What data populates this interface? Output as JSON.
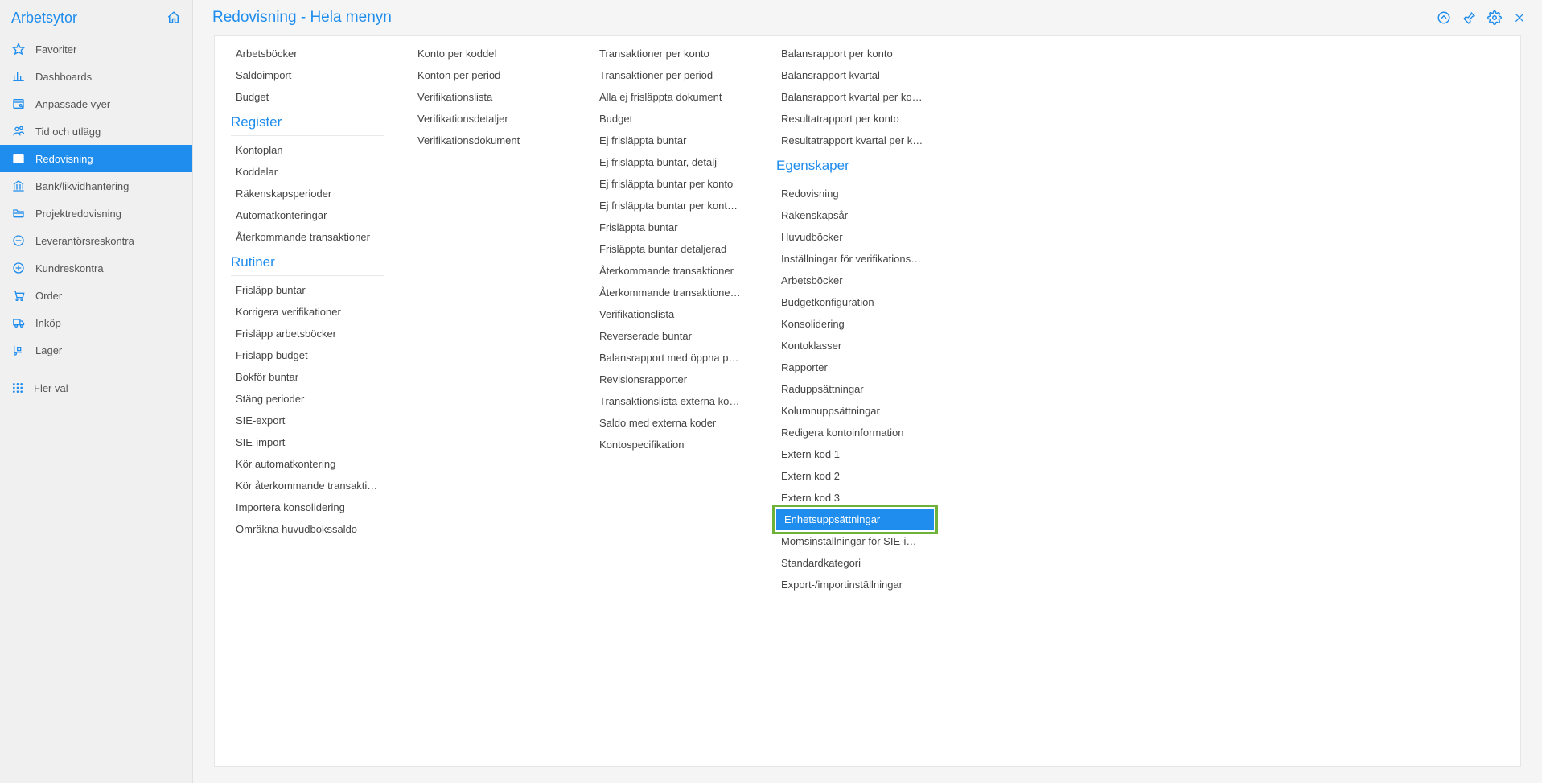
{
  "sidebar": {
    "title": "Arbetsytor",
    "items": [
      {
        "icon": "star",
        "label": "Favoriter"
      },
      {
        "icon": "bar",
        "label": "Dashboards"
      },
      {
        "icon": "view",
        "label": "Anpassade vyer"
      },
      {
        "icon": "user",
        "label": "Tid och utlägg"
      },
      {
        "icon": "dollar",
        "label": "Redovisning",
        "active": true
      },
      {
        "icon": "bank",
        "label": "Bank/likvidhantering"
      },
      {
        "icon": "folder",
        "label": "Projektredovisning"
      },
      {
        "icon": "minus",
        "label": "Leverantörsreskontra"
      },
      {
        "icon": "plus",
        "label": "Kundreskontra"
      },
      {
        "icon": "cart",
        "label": "Order"
      },
      {
        "icon": "truck",
        "label": "Inköp"
      },
      {
        "icon": "dolly",
        "label": "Lager"
      }
    ],
    "more": "Fler val"
  },
  "header": {
    "breadcrumb": "Redovisning - Hela menyn"
  },
  "columns": [
    {
      "blocks": [
        {
          "type": "links",
          "items": [
            "Arbetsböcker",
            "Saldoimport",
            "Budget"
          ]
        },
        {
          "type": "title",
          "text": "Register"
        },
        {
          "type": "links",
          "items": [
            "Kontoplan",
            "Koddelar",
            "Räkenskapsperioder",
            "Automatkonteringar",
            "Återkommande transaktioner"
          ]
        },
        {
          "type": "title",
          "text": "Rutiner"
        },
        {
          "type": "links",
          "items": [
            "Frisläpp buntar",
            "Korrigera verifikationer",
            "Frisläpp arbetsböcker",
            "Frisläpp budget",
            "Bokför buntar",
            "Stäng perioder",
            "SIE-export",
            "SIE-import",
            "Kör automatkontering",
            "Kör återkommande transaktioner",
            "Importera konsolidering",
            "Omräkna huvudbokssaldo"
          ]
        }
      ]
    },
    {
      "blocks": [
        {
          "type": "links",
          "items": [
            "Konto per koddel",
            "Konton per period",
            "Verifikationslista",
            "Verifikationsdetaljer",
            "Verifikationsdokument"
          ]
        }
      ]
    },
    {
      "blocks": [
        {
          "type": "links",
          "items": [
            "Transaktioner per konto",
            "Transaktioner per period",
            "Alla ej frisläppta dokument",
            "Budget",
            "Ej frisläppta buntar",
            "Ej frisläppta buntar, detalj",
            "Ej frisläppta buntar per konto",
            "Ej frisläppta buntar per konto, valuta",
            "Frisläppta buntar",
            "Frisläppta buntar detaljerad",
            "Återkommande transaktioner",
            "Återkommande transaktioner (detalj...",
            "Verifikationslista",
            "Reverserade buntar",
            "Balansrapport med öppna poster",
            "Revisionsrapporter",
            "Transaktionslista externa koder",
            "Saldo med externa koder",
            "Kontospecifikation"
          ]
        }
      ]
    },
    {
      "blocks": [
        {
          "type": "links",
          "items": [
            "Balansrapport per konto",
            "Balansrapport kvartal",
            "Balansrapport kvartal per konto",
            "Resultatrapport per konto",
            "Resultatrapport kvartal per konto"
          ]
        },
        {
          "type": "title",
          "text": "Egenskaper"
        },
        {
          "type": "links",
          "items": [
            "Redovisning",
            "Räkenskapsår",
            "Huvudböcker",
            "Inställningar för verifikationsavstäm...",
            "Arbetsböcker",
            "Budgetkonfiguration",
            "Konsolidering",
            "Kontoklasser",
            "Rapporter",
            "Raduppsättningar",
            "Kolumnuppsättningar",
            "Redigera kontoinformation",
            "Extern kod 1",
            "Extern kod 2",
            "Extern kod 3",
            {
              "text": "Enhetsuppsättningar",
              "highlighted": true
            },
            "Momsinställningar för SIE-import",
            "Standardkategori",
            "Export-/importinställningar"
          ]
        }
      ]
    }
  ]
}
